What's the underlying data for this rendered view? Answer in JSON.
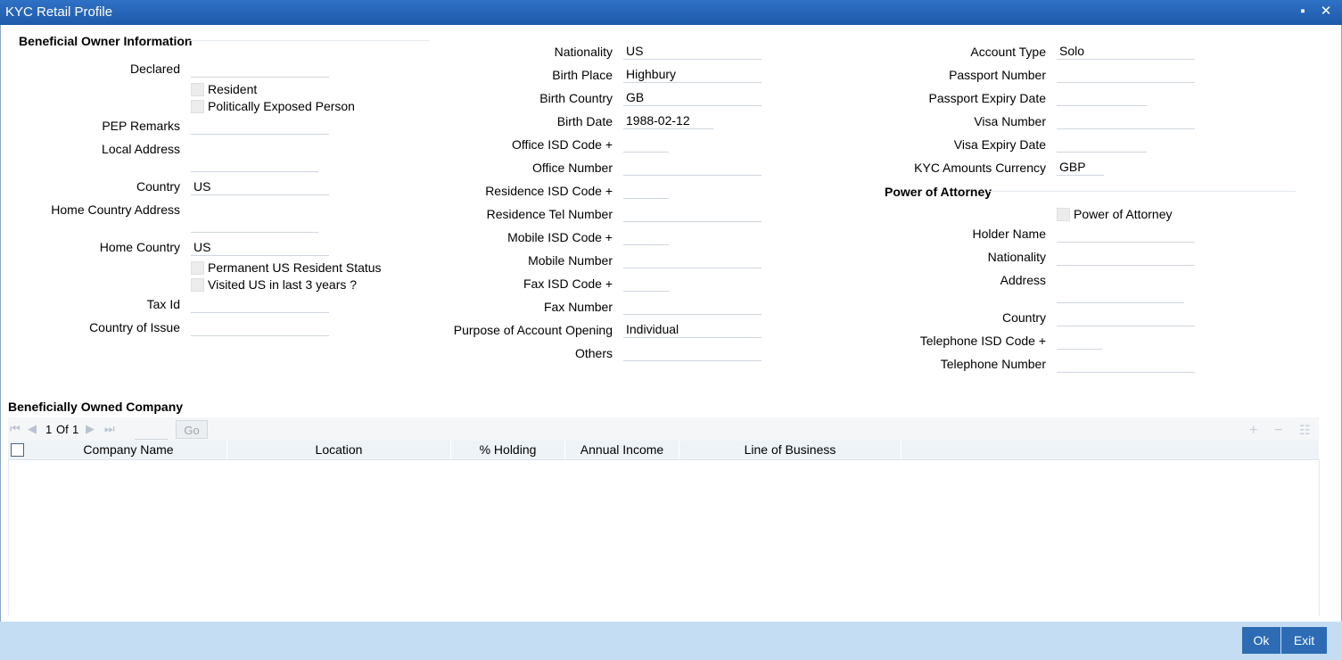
{
  "window": {
    "title": "KYC Retail Profile",
    "minimize": "▪",
    "close": "✕"
  },
  "beneficial": {
    "section_title": "Beneficial Owner Information",
    "declared_label": "Declared",
    "declared_value": "",
    "resident_label": "Resident",
    "pep_label": "Politically Exposed Person",
    "pep_remarks_label": "PEP Remarks",
    "pep_remarks_value": "",
    "local_address_label": "Local Address",
    "local_address_value": "",
    "country_label": "Country",
    "country_value": "US",
    "home_addr_label": "Home Country Address",
    "home_addr_value": "",
    "home_country_label": "Home Country",
    "home_country_value": "US",
    "perm_us_label": "Permanent US Resident Status",
    "visited_label": "Visited US in last 3 years ?",
    "tax_id_label": "Tax Id",
    "tax_id_value": "",
    "country_issue_label": "Country of Issue",
    "country_issue_value": ""
  },
  "middle": {
    "nationality_label": "Nationality",
    "nationality_value": "US",
    "birth_place_label": "Birth Place",
    "birth_place_value": "Highbury",
    "birth_country_label": "Birth Country",
    "birth_country_value": "GB",
    "birth_date_label": "Birth Date",
    "birth_date_value": "1988-02-12",
    "office_isd_label": "Office ISD Code +",
    "office_isd_value": "",
    "office_number_label": "Office Number",
    "office_number_value": "",
    "res_isd_label": "Residence ISD Code +",
    "res_isd_value": "",
    "res_tel_label": "Residence Tel Number",
    "res_tel_value": "",
    "mobile_isd_label": "Mobile ISD Code +",
    "mobile_isd_value": "",
    "mobile_number_label": "Mobile Number",
    "mobile_number_value": "",
    "fax_isd_label": "Fax ISD Code +",
    "fax_isd_value": "",
    "fax_number_label": "Fax Number",
    "fax_number_value": "",
    "purpose_label": "Purpose of Account Opening",
    "purpose_value": "Individual",
    "others_label": "Others",
    "others_value": ""
  },
  "right": {
    "account_type_label": "Account Type",
    "account_type_value": "Solo",
    "passport_label": "Passport Number",
    "passport_value": "",
    "passport_exp_label": "Passport Expiry Date",
    "passport_exp_value": "",
    "visa_label": "Visa Number",
    "visa_value": "",
    "visa_exp_label": "Visa Expiry Date",
    "visa_exp_value": "",
    "kyc_ccy_label": "KYC Amounts Currency",
    "kyc_ccy_value": "GBP"
  },
  "poa": {
    "section_title": "Power of Attorney",
    "checkbox_label": "Power of Attorney",
    "holder_label": "Holder Name",
    "holder_value": "",
    "nationality_label": "Nationality",
    "nationality_value": "",
    "address_label": "Address",
    "address_value": "",
    "country_label": "Country",
    "country_value": "",
    "tel_isd_label": "Telephone ISD Code +",
    "tel_isd_value": "",
    "tel_number_label": "Telephone Number",
    "tel_number_value": ""
  },
  "company": {
    "section_title": "Beneficially Owned Company",
    "page_current": "1",
    "page_of": "Of",
    "page_total": "1",
    "go_label": "Go",
    "columns": [
      "Company Name",
      "Location",
      "% Holding",
      "Annual Income",
      "Line of Business"
    ]
  },
  "footer": {
    "ok_label": "Ok",
    "exit_label": "Exit"
  }
}
